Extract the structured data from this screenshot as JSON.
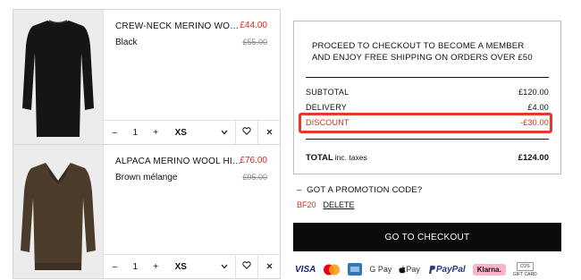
{
  "cart": {
    "items": [
      {
        "name": "CREW-NECK MERINO WOOL TOP",
        "price": "£44.00",
        "variant": "Black",
        "old_price": "£55.00",
        "quantity": "1",
        "minus": "–",
        "plus": "+",
        "size": "XS",
        "color": "#1a1a1a"
      },
      {
        "name": "ALPACA MERINO WOOL HIGH-N...",
        "price": "£76.00",
        "variant": "Brown mélange",
        "old_price": "£95.00",
        "quantity": "1",
        "minus": "–",
        "plus": "+",
        "size": "XS",
        "color": "#4a3a2a"
      }
    ]
  },
  "summary": {
    "promo_message": "PROCEED TO CHECKOUT TO BECOME A MEMBER AND ENJOY FREE SHIPPING ON ORDERS OVER £50",
    "subtotal_label": "SUBTOTAL",
    "subtotal_value": "£120.00",
    "delivery_label": "DELIVERY",
    "delivery_value": "£4.00",
    "discount_label": "DISCOUNT",
    "discount_value": "-£30.00",
    "total_label": "TOTAL",
    "total_note": "inc. taxes",
    "total_value": "£124.00"
  },
  "promotion": {
    "question": "GOT A PROMOTION CODE?",
    "toggle": "–",
    "code": "BF20",
    "delete_label": "DELETE"
  },
  "checkout_label": "GO TO CHECKOUT",
  "payments": {
    "visa": "VISA",
    "gpay": "G Pay",
    "apay": "Pay",
    "paypal": "PayPal",
    "klarna": "Klarna.",
    "cos": "COS",
    "giftcard": "GIFT CARD"
  },
  "colors": {
    "accent_red": "#d42d20",
    "highlight_box": "#e23b2e",
    "button_bg": "#0b0b0b"
  }
}
